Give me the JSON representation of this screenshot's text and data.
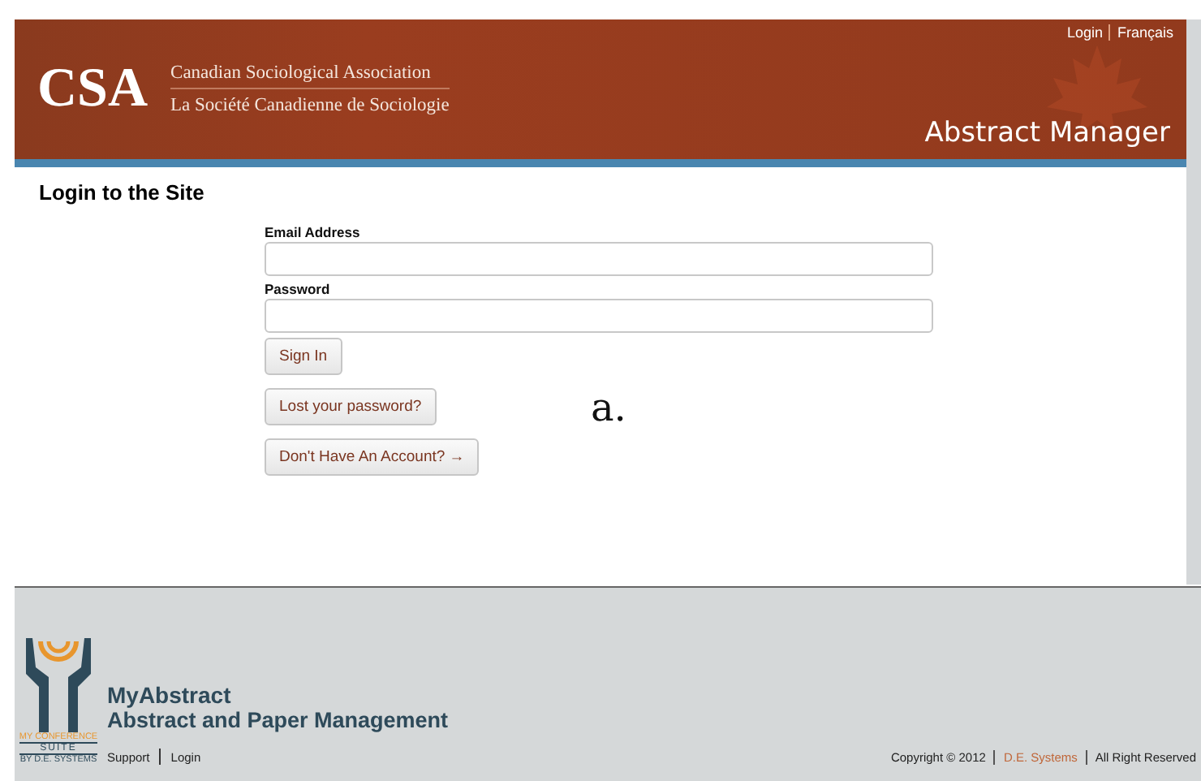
{
  "header": {
    "top_links": [
      "Login",
      "Français"
    ],
    "logo_text": "CSA",
    "org_name_en": "Canadian Sociological Association",
    "org_name_fr": "La Société Canadienne de Sociologie",
    "app_title": "Abstract Manager"
  },
  "page_title": "Login to the Site",
  "form": {
    "fields": [
      {
        "label": "Email Address"
      },
      {
        "label": "Password"
      }
    ],
    "buttons": [
      "Sign In",
      "Lost your password?",
      "Don't Have An Account? →"
    ]
  },
  "figure_label": "a.",
  "footer": {
    "badge": {
      "line1": "MY CONFERENCE",
      "line2": "SUITE",
      "line3": "BY D.E. SYSTEMS"
    },
    "product": "MyAbstract",
    "tagline": "Abstract and Paper Management",
    "links": [
      "Support",
      "Login"
    ],
    "copyright": {
      "before": "Copyright © 2012",
      "link": "D.E. Systems",
      "after": "All Right Reserved"
    }
  }
}
